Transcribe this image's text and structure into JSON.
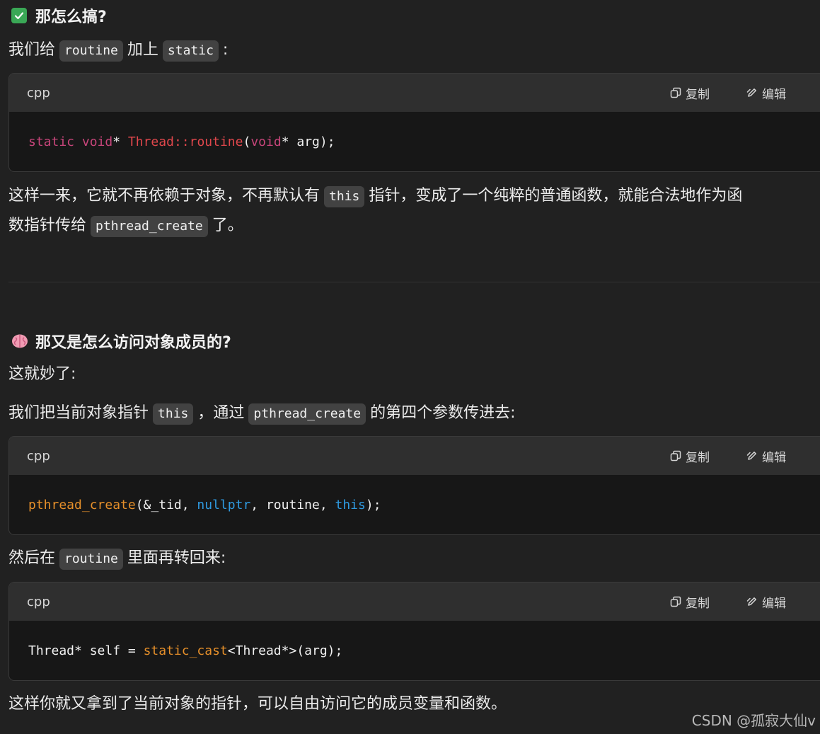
{
  "section1": {
    "heading": "那怎么搞?",
    "intro": {
      "before": "我们给",
      "code1": "routine",
      "mid": "加上",
      "code2": "static",
      "after": ":"
    }
  },
  "code_labels": {
    "lang": "cpp",
    "copy": "复制",
    "edit": "编辑"
  },
  "code1": {
    "t1": "static",
    "t2": " ",
    "t3": "void",
    "t4": "* ",
    "t5": "Thread::routine",
    "t6": "(",
    "t7": "void",
    "t8": "* arg);"
  },
  "para1": {
    "a": "这样一来，它就不再依赖于对象，不再默认有",
    "code": "this",
    "b": "指针，变成了一个纯粹的普通函数，就能合法地作为函",
    "c": "数指针传给",
    "code2": "pthread_create",
    "d": "了。"
  },
  "section2": {
    "heading": "那又是怎么访问对象成员的?",
    "line1": "这就妙了:",
    "line2": {
      "a": "我们把当前对象指针",
      "code1": "this",
      "b": "，通过",
      "code2": "pthread_create",
      "c": "的第四个参数传进去:"
    }
  },
  "code2": {
    "t1": "pthread_create",
    "t2": "(&_tid, ",
    "t3": "nullptr",
    "t4": ", routine, ",
    "t5": "this",
    "t6": ");"
  },
  "para2": {
    "a": "然后在",
    "code": "routine",
    "b": "里面再转回来:"
  },
  "code3": {
    "t1": "Thread* self = ",
    "t2": "static_cast",
    "t3": "<Thread*>(arg);"
  },
  "para3": "这样你就又拿到了当前对象的指针，可以自由访问它的成员变量和函数。",
  "watermark": "CSDN @孤寂大仙v",
  "colors": {
    "background": "#212121",
    "keyword": "#c7457a",
    "function": "#e0474c",
    "function_orange": "#e58f2a",
    "literal": "#2f9ae0"
  }
}
